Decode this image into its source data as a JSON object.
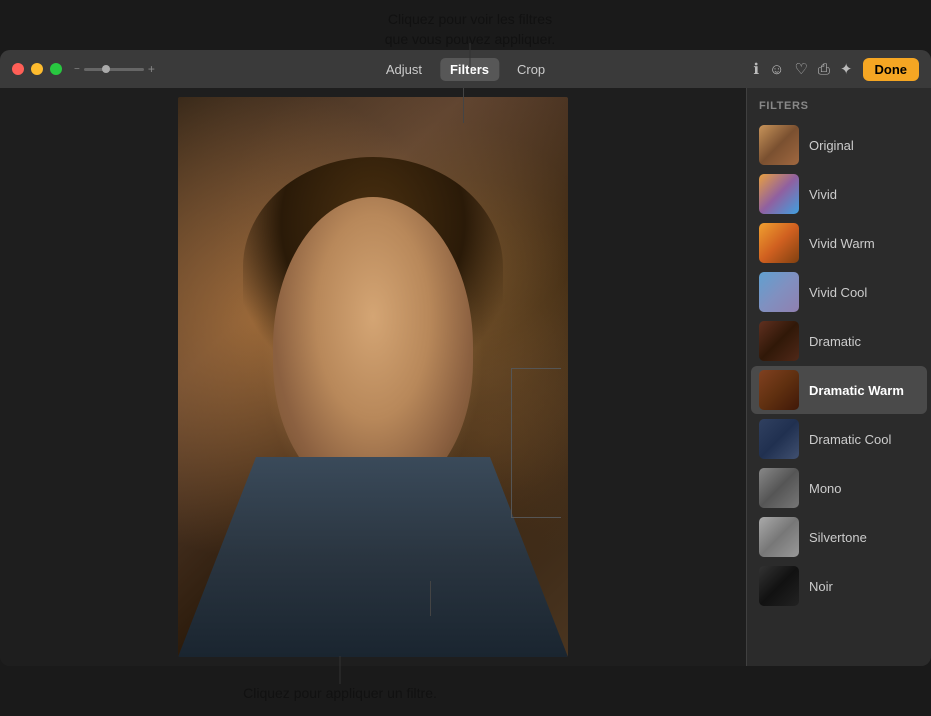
{
  "tooltip_top": {
    "text": "Cliquez pour voir les filtres\nque vous pouvez appliquer."
  },
  "tooltip_bottom": {
    "text": "Cliquez pour appliquer un filtre."
  },
  "titlebar": {
    "tabs": [
      {
        "id": "adjust",
        "label": "Adjust",
        "active": false
      },
      {
        "id": "filters",
        "label": "Filters",
        "active": true
      },
      {
        "id": "crop",
        "label": "Crop",
        "active": false
      }
    ],
    "done_label": "Done"
  },
  "filters_panel": {
    "title": "FILTERS",
    "items": [
      {
        "id": "original",
        "label": "Original",
        "selected": false,
        "thumb_class": "thumb-original"
      },
      {
        "id": "vivid",
        "label": "Vivid",
        "selected": false,
        "thumb_class": "thumb-vivid"
      },
      {
        "id": "vivid-warm",
        "label": "Vivid Warm",
        "selected": false,
        "thumb_class": "thumb-vivid-warm"
      },
      {
        "id": "vivid-cool",
        "label": "Vivid Cool",
        "selected": false,
        "thumb_class": "thumb-vivid-cool"
      },
      {
        "id": "dramatic",
        "label": "Dramatic",
        "selected": false,
        "thumb_class": "thumb-dramatic"
      },
      {
        "id": "dramatic-warm",
        "label": "Dramatic Warm",
        "selected": true,
        "thumb_class": "thumb-dramatic-warm"
      },
      {
        "id": "dramatic-cool",
        "label": "Dramatic Cool",
        "selected": false,
        "thumb_class": "thumb-dramatic-cool"
      },
      {
        "id": "mono",
        "label": "Mono",
        "selected": false,
        "thumb_class": "thumb-mono"
      },
      {
        "id": "silvertone",
        "label": "Silvertone",
        "selected": false,
        "thumb_class": "thumb-silvertone"
      },
      {
        "id": "noir",
        "label": "Noir",
        "selected": false,
        "thumb_class": "thumb-noir"
      }
    ]
  }
}
